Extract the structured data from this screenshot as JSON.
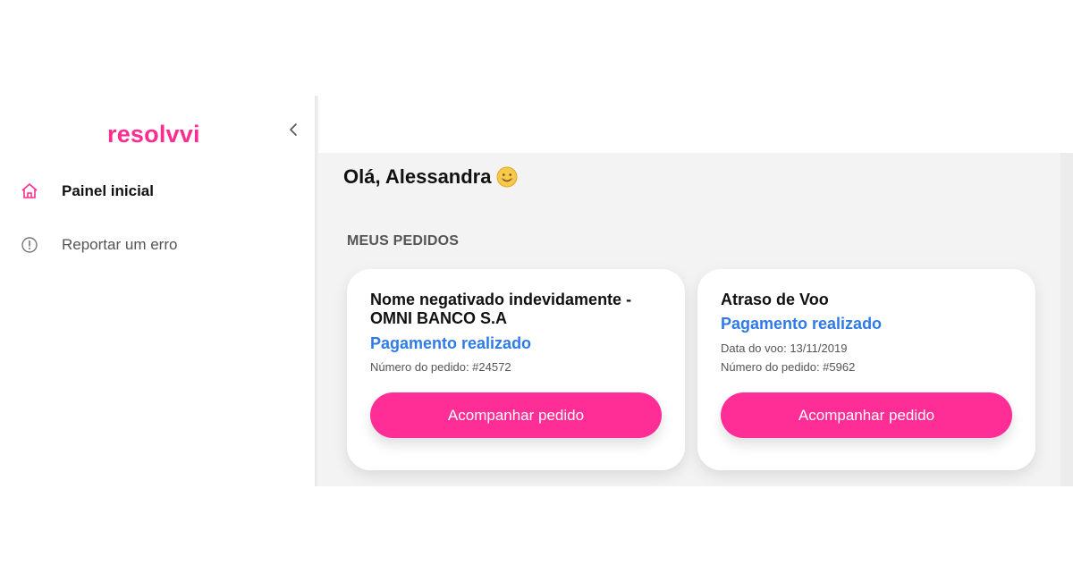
{
  "brand": {
    "logo_text": "resolvvi",
    "accent_color": "#ff2d95",
    "status_color": "#2f7be6"
  },
  "sidebar": {
    "collapse_icon": "chevron-left-icon",
    "items": [
      {
        "label": "Painel inicial",
        "icon": "home-icon",
        "active": true
      },
      {
        "label": "Reportar um erro",
        "icon": "alert-circle-icon",
        "active": false
      }
    ]
  },
  "main": {
    "greeting": "Olá, Alessandra",
    "greeting_emoji": "smile-emoji",
    "section_title": "MEUS PEDIDOS",
    "orders": [
      {
        "title": "Nome negativado indevidamente - OMNI BANCO S.A",
        "status": "Pagamento realizado",
        "meta": [
          "Número do pedido: #24572"
        ],
        "button_label": "Acompanhar pedido"
      },
      {
        "title": "Atraso de Voo",
        "status": "Pagamento realizado",
        "meta": [
          "Data do voo: 13/11/2019",
          "Número do pedido: #5962"
        ],
        "button_label": "Acompanhar pedido"
      }
    ]
  }
}
